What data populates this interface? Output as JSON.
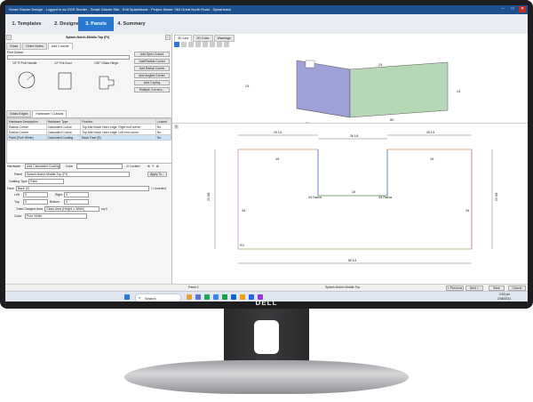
{
  "window": {
    "title": "Smart Glazier Design - Logged in as GGS Shelter - Smart Glazier Site - Edit Splashback - Project Name: 064 Great North Road - Splashback",
    "controls": [
      "–",
      "□",
      "✕"
    ]
  },
  "wizard": {
    "steps": [
      {
        "label": "1. Templates"
      },
      {
        "label": "2. Designer"
      },
      {
        "label": "3. Panels"
      },
      {
        "label": "4. Summary"
      }
    ],
    "active_index": 2
  },
  "panel_selector": {
    "value": "Splash-Notch-Middle-Top (Pt)"
  },
  "left_tabs": [
    "Glass",
    "Order Notes",
    "Add Cutouts"
  ],
  "find_cutout": {
    "label": "Find Cutout"
  },
  "cutout_previews": [
    {
      "label": "15\" R Pull Handle"
    },
    {
      "label": "12\" Pot Door"
    },
    {
      "label": "135° Glass Hinge"
    }
  ],
  "cutout_actions": [
    "Add Spec Cutout",
    "Just/Radius Corner",
    "Add Radial Corner",
    "Add Angled Corner",
    "Add Coping",
    "Multiple Corners..."
  ],
  "sub_tabs": [
    "Glass Edges",
    "Hardware / Cutouts"
  ],
  "hardware_table": {
    "headers": [
      "Hardware Description",
      "Hardware Type",
      "Position",
      "Locked"
    ],
    "rows": [
      [
        "Radius Corner",
        "Calculated Cutout",
        "Top-Mid Notch Horiz edge, Right end corner",
        "No"
      ],
      [
        "Radius Corner",
        "Calculated Cutout",
        "Top-Mid Notch Horiz edge, Left end corner",
        "No"
      ],
      [
        "Paint (Pure White)",
        "Calculated Coating",
        "Back Face (B)",
        "No"
      ]
    ]
  },
  "detail": {
    "hardware_label": "Hardware",
    "hardware_value": "Add Calculated Coating",
    "color_label": "Color",
    "locked_label": "Locked",
    "panel_label": "Panel",
    "panel_value": "Splash-Notch-Middle-Top (Pt)",
    "apply_label": "Apply To...",
    "coating_type_label": "Coating Type",
    "coating_type_value": "Paint",
    "face_label": "Face",
    "face_value": "Back (0)",
    "inverted_label": "Inverted",
    "left_label": "Left",
    "left_value": "0",
    "right_label": "Right",
    "right_value": "0",
    "top_label": "Top",
    "top_value": "0",
    "bottom_label": "Bottom",
    "bottom_value": "0",
    "total_area_label": "Total Charged Area",
    "total_area_value": "Glass Area (Height x Width)",
    "area_unit": "sq ft",
    "color2_label": "Color",
    "color2_value": "Pure White"
  },
  "view_tabs": [
    "3D Line",
    "2D Color",
    "Warnings"
  ],
  "view_3d": {
    "dims": [
      "24",
      "24",
      "80",
      "80",
      "24",
      "24"
    ]
  },
  "view_2d": {
    "dims_top": [
      "28 1/4",
      "36 1/4",
      "28 1/4"
    ],
    "dims_side": [
      "23 5/8",
      "23 5/8"
    ],
    "dims_bottom": "86 1/4",
    "inner_labels": [
      "3/4 Radius",
      "3/4 Radius",
      "3/4",
      "3/4",
      "3/4",
      "3/4",
      "3/4",
      "R/2"
    ]
  },
  "status": {
    "panel_counter": "Panel 1",
    "panel_name": "Splash-Notch-Middle-Top"
  },
  "nav": {
    "previous": "< Previous",
    "next": "Next >",
    "save": "Save",
    "cancel": "Cancel"
  },
  "taskbar": {
    "search_placeholder": "Search",
    "time": "3:52 pm",
    "date": "2/08/2024"
  },
  "brand": "DELL",
  "colors": {
    "title_bar": "#1e4f8f",
    "active_step": "#2a78d0",
    "panel_wall_left": "#9ea0d8",
    "panel_wall_right": "#b6d8b6"
  }
}
